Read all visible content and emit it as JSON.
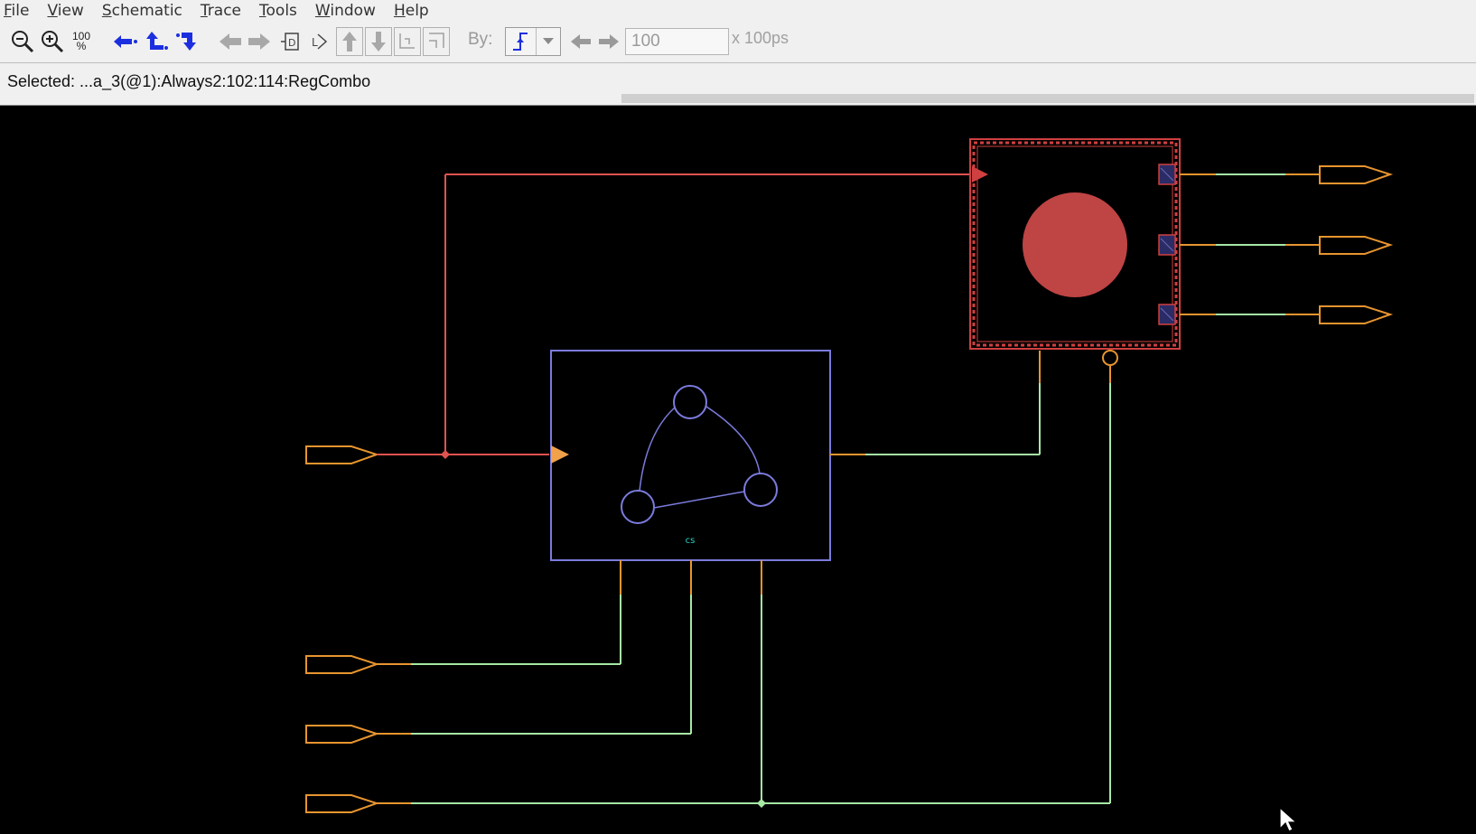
{
  "menubar": {
    "items": [
      {
        "label": "File",
        "mnemonic": "F",
        "rest": "ile"
      },
      {
        "label": "View",
        "mnemonic": "V",
        "rest": "iew"
      },
      {
        "label": "Schematic",
        "mnemonic": "S",
        "rest": "chematic"
      },
      {
        "label": "Trace",
        "mnemonic": "T",
        "rest": "race"
      },
      {
        "label": "Tools",
        "mnemonic": "T",
        "rest": "ools"
      },
      {
        "label": "Window",
        "mnemonic": "W",
        "rest": "indow"
      },
      {
        "label": "Help",
        "mnemonic": "H",
        "rest": "elp"
      }
    ]
  },
  "toolbar": {
    "zoom_100_label": "100",
    "zoom_100_pct": "%",
    "by_label": "By:",
    "step_value": "100",
    "step_unit": "x 100ps",
    "colors": {
      "trace_blue": "#1c2fe0",
      "disabled_gray": "#9a9a9a"
    }
  },
  "status": {
    "selected_text": "Selected: ...a_3(@1):Always2:102:114:RegCombo"
  },
  "schematic": {
    "fsm_label": "cs",
    "colors": {
      "background": "#000000",
      "port": "#e8952f",
      "wire_selected": "#e0524f",
      "wire_normal": "#a6e8a6",
      "fsm_block": "#7b7bdd",
      "fsm_label": "#25d0c0",
      "register_fill": "#bf4444",
      "register_border": "#d04040"
    }
  }
}
